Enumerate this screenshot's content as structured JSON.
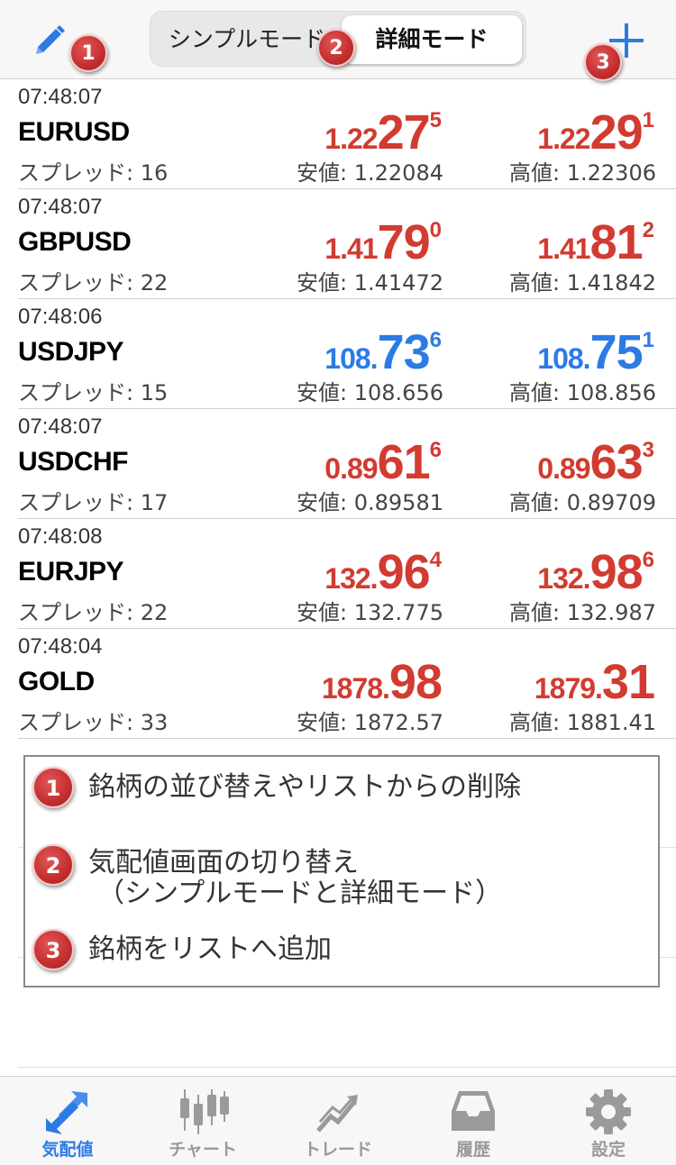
{
  "header": {
    "segments": [
      {
        "label": "シンプルモード",
        "selected": false
      },
      {
        "label": "詳細モード",
        "selected": true
      }
    ],
    "edit_icon": "pencil-icon",
    "add_icon": "plus-icon"
  },
  "badges": [
    "1",
    "2",
    "3"
  ],
  "quotes": [
    {
      "time": "07:48:07",
      "symbol": "EURUSD",
      "spread": "スプレッド: 16",
      "color": "#d23b30",
      "bid": {
        "small": "1.22",
        "big": "27",
        "sup": "5"
      },
      "ask": {
        "small": "1.22",
        "big": "29",
        "sup": "1"
      },
      "low": "安値: 1.22084",
      "high": "高値: 1.22306"
    },
    {
      "time": "07:48:07",
      "symbol": "GBPUSD",
      "spread": "スプレッド: 22",
      "color": "#d23b30",
      "bid": {
        "small": "1.41",
        "big": "79",
        "sup": "0"
      },
      "ask": {
        "small": "1.41",
        "big": "81",
        "sup": "2"
      },
      "low": "安値: 1.41472",
      "high": "高値: 1.41842"
    },
    {
      "time": "07:48:06",
      "symbol": "USDJPY",
      "spread": "スプレッド: 15",
      "color": "#2c7be5",
      "bid": {
        "small": "108.",
        "big": "73",
        "sup": "6"
      },
      "ask": {
        "small": "108.",
        "big": "75",
        "sup": "1"
      },
      "low": "安値: 108.656",
      "high": "高値: 108.856"
    },
    {
      "time": "07:48:07",
      "symbol": "USDCHF",
      "spread": "スプレッド: 17",
      "color": "#d23b30",
      "bid": {
        "small": "0.89",
        "big": "61",
        "sup": "6"
      },
      "ask": {
        "small": "0.89",
        "big": "63",
        "sup": "3"
      },
      "low": "安値: 0.89581",
      "high": "高値: 0.89709"
    },
    {
      "time": "07:48:08",
      "symbol": "EURJPY",
      "spread": "スプレッド: 22",
      "color": "#d23b30",
      "bid": {
        "small": "132.",
        "big": "96",
        "sup": "4"
      },
      "ask": {
        "small": "132.",
        "big": "98",
        "sup": "6"
      },
      "low": "安値: 132.775",
      "high": "高値: 132.987"
    },
    {
      "time": "07:48:04",
      "symbol": "GOLD",
      "spread": "スプレッド: 33",
      "color": "#d23b30",
      "bid": {
        "small": "1878.",
        "big": "98",
        "sup": ""
      },
      "ask": {
        "small": "1879.",
        "big": "31",
        "sup": ""
      },
      "low": "安値: 1872.57",
      "high": "高値: 1881.41"
    }
  ],
  "legend": [
    {
      "num": "1",
      "text": "銘柄の並び替えやリストからの削除"
    },
    {
      "num": "2",
      "text": "気配値画面の切り替え",
      "text2": "（シンプルモードと詳細モード）"
    },
    {
      "num": "3",
      "text": "銘柄をリストへ追加"
    }
  ],
  "tabs": [
    {
      "label": "気配値",
      "icon": "quotes-arrows-icon",
      "active": true
    },
    {
      "label": "チャート",
      "icon": "candlestick-chart-icon",
      "active": false
    },
    {
      "label": "トレード",
      "icon": "trade-chart-icon",
      "active": false
    },
    {
      "label": "履歴",
      "icon": "inbox-tray-icon",
      "active": false
    },
    {
      "label": "設定",
      "icon": "gear-icon",
      "active": false
    }
  ],
  "colors": {
    "accent": "#2c7be5",
    "down": "#d23b30",
    "badge": "#c32e2e"
  }
}
